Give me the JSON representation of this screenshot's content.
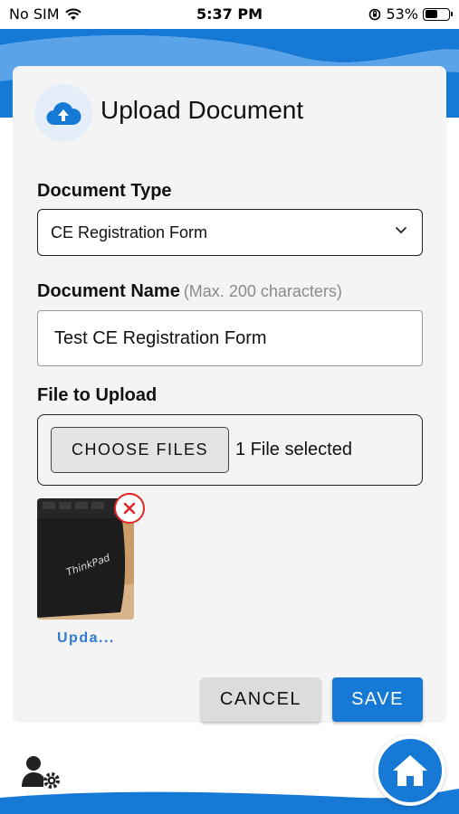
{
  "status_bar": {
    "carrier": "No SIM",
    "time": "5:37 PM",
    "battery_percent": "53%",
    "battery_level": 0.53
  },
  "dialog": {
    "title": "Upload Document",
    "document_type": {
      "label": "Document Type",
      "selected": "CE Registration Form"
    },
    "document_name": {
      "label": "Document Name",
      "hint": "(Max. 200 characters)",
      "value": "Test CE Registration Form"
    },
    "file_upload": {
      "label": "File to Upload",
      "button_label": "CHOOSE FILES",
      "status": "1 File selected"
    },
    "thumbnail": {
      "caption": "Upda...",
      "image_text": "ThinkPad"
    },
    "actions": {
      "cancel_label": "CANCEL",
      "save_label": "SAVE"
    }
  },
  "nav": {
    "profile_icon": "user-settings-icon",
    "home_icon": "home-icon"
  },
  "colors": {
    "accent": "#1779d6",
    "danger": "#e02424",
    "link": "#2f7bd0",
    "card_bg": "#f4f4f4"
  }
}
